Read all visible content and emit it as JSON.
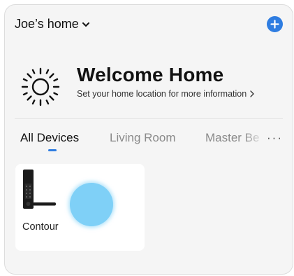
{
  "header": {
    "home_name": "Joe’s home",
    "home_dropdown_icon": "chevron-down-icon",
    "add_icon": "plus-icon",
    "accent_color": "#2f7de1"
  },
  "welcome": {
    "icon": "sun-icon",
    "title": "Welcome Home",
    "subtitle": "Set your home location for more information",
    "subtitle_icon": "chevron-right-icon"
  },
  "tabs": {
    "items": [
      {
        "label": "All Devices",
        "active": true
      },
      {
        "label": "Living Room",
        "active": false
      },
      {
        "label": "Master Be",
        "active": false
      }
    ],
    "more_label": "···"
  },
  "devices": [
    {
      "name": "Contour",
      "icon": "smart-lock-icon"
    }
  ]
}
